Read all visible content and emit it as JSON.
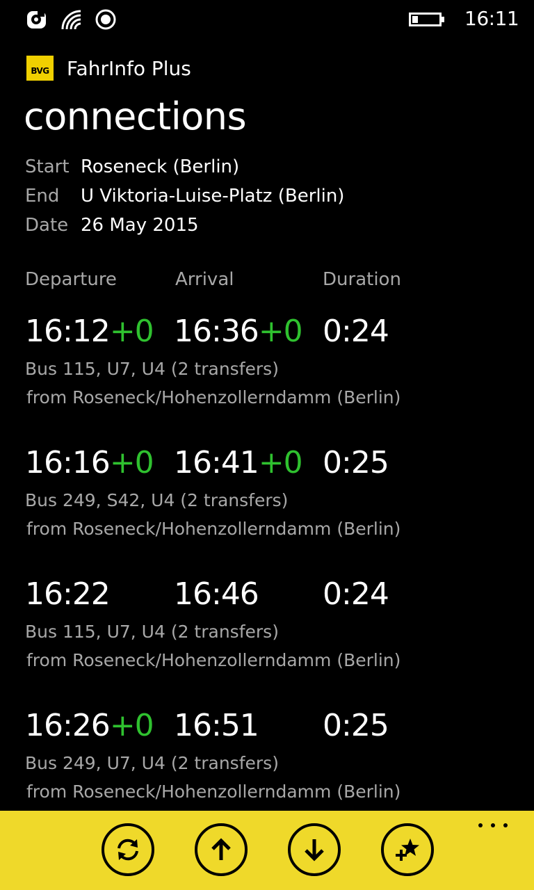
{
  "status_bar": {
    "time": "16:11",
    "icons": [
      "nfc-icon",
      "wifi-icon",
      "location-icon",
      "battery-icon"
    ]
  },
  "app": {
    "logo_text": "BVG",
    "title": "FahrInfo Plus",
    "brand_color": "#efd92a"
  },
  "page": {
    "title": "connections"
  },
  "trip": {
    "start_label": "Start",
    "start_value": "Roseneck (Berlin)",
    "end_label": "End",
    "end_value": "U Viktoria-Luise-Platz (Berlin)",
    "date_label": "Date",
    "date_value": "26 May 2015"
  },
  "columns": {
    "departure": "Departure",
    "arrival": "Arrival",
    "duration": "Duration"
  },
  "connections": [
    {
      "departure": "16:12",
      "departure_delay": "+0",
      "arrival": "16:36",
      "arrival_delay": "+0",
      "duration": "0:24",
      "lines": "Bus 115, U7, U4 (2 transfers)",
      "from": "from Roseneck/Hohenzollerndamm (Berlin)"
    },
    {
      "departure": "16:16",
      "departure_delay": "+0",
      "arrival": "16:41",
      "arrival_delay": "+0",
      "duration": "0:25",
      "lines": "Bus 249, S42, U4 (2 transfers)",
      "from": "from Roseneck/Hohenzollerndamm (Berlin)"
    },
    {
      "departure": "16:22",
      "departure_delay": "",
      "arrival": "16:46",
      "arrival_delay": "",
      "duration": "0:24",
      "lines": "Bus 115, U7, U4 (2 transfers)",
      "from": "from Roseneck/Hohenzollerndamm (Berlin)"
    },
    {
      "departure": "16:26",
      "departure_delay": "+0",
      "arrival": "16:51",
      "arrival_delay": "",
      "duration": "0:25",
      "lines": "Bus 249, U7, U4 (2 transfers)",
      "from": "from Roseneck/Hohenzollerndamm (Berlin)"
    }
  ],
  "app_bar": {
    "buttons": [
      "refresh-icon",
      "earlier-icon",
      "later-icon",
      "add-favorite-icon"
    ],
    "more_label": "..."
  },
  "colors": {
    "background": "#000000",
    "text_primary": "#ffffff",
    "text_secondary": "#a8a8a8",
    "on_time": "#2fc12f",
    "accent": "#efd92a"
  }
}
